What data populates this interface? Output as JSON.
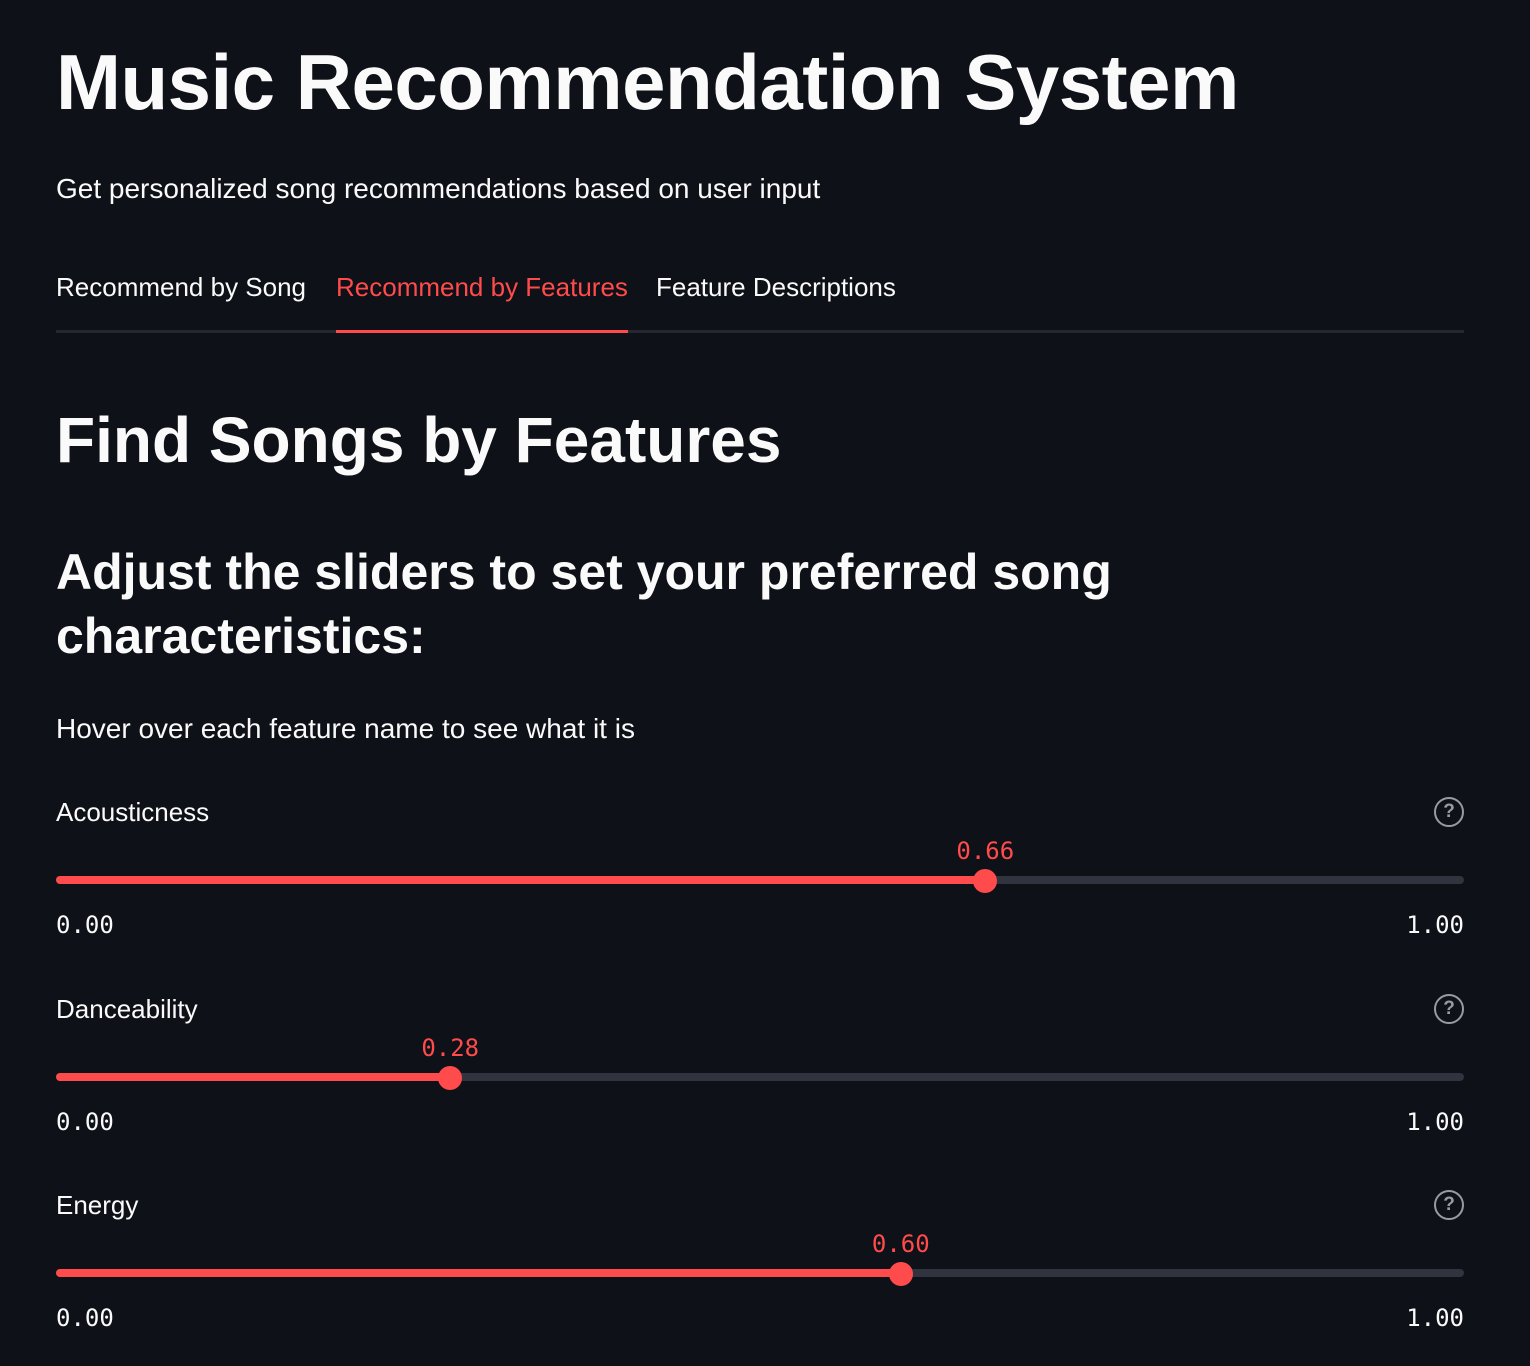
{
  "header": {
    "title": "Music Recommendation System",
    "subtitle": "Get personalized song recommendations based on user input"
  },
  "tabs": [
    {
      "label": "Recommend by Song",
      "active": false
    },
    {
      "label": "Recommend by Features",
      "active": true
    },
    {
      "label": "Feature Descriptions",
      "active": false
    }
  ],
  "section": {
    "title": "Find Songs by Features",
    "subtitle": "Adjust the sliders to set your preferred song characteristics:",
    "hint": "Hover over each feature name to see what it is"
  },
  "sliders": [
    {
      "label": "Acousticness",
      "value": 0.66,
      "value_text": "0.66",
      "min": "0.00",
      "max": "1.00",
      "help_icon": "question-circle-icon"
    },
    {
      "label": "Danceability",
      "value": 0.28,
      "value_text": "0.28",
      "min": "0.00",
      "max": "1.00",
      "help_icon": "question-circle-icon"
    },
    {
      "label": "Energy",
      "value": 0.6,
      "value_text": "0.60",
      "min": "0.00",
      "max": "1.00",
      "help_icon": "question-circle-icon"
    }
  ],
  "colors": {
    "background": "#0e1117",
    "accent": "#ff4b4b",
    "track": "#31333f",
    "text": "#fafafa"
  }
}
